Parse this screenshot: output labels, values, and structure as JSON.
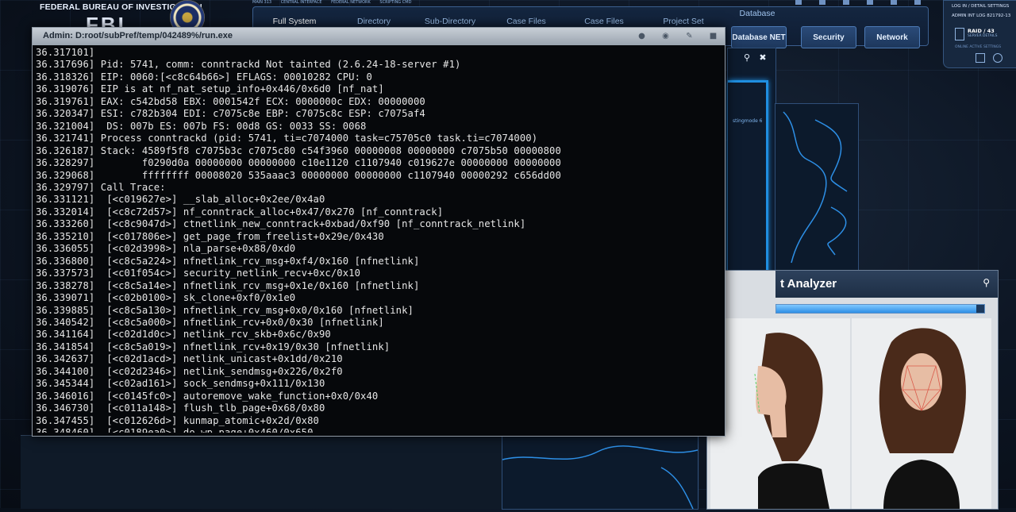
{
  "agency": {
    "title": "FEDERAL BUREAU OF INVESTIGATION",
    "abbr": "FBI"
  },
  "topnav": {
    "strip": [
      "MAIN 313",
      "CENTRAL INTERFACE",
      "FEDERAL NETWORK",
      "SCRIPTING CMD"
    ],
    "tabs": [
      "Full System",
      "Directory",
      "Sub-Directory",
      "Case Files",
      "Case Files",
      "Project Set",
      "Database"
    ],
    "buttons": [
      "Database NET",
      "Security",
      "Network"
    ]
  },
  "right_panel": {
    "line1": "LOG IN / DETAIL SETTINGS",
    "line2": "ADMIN INT LOG 821792-13",
    "raid": "RAID / 43",
    "raid_sub": "SERVER DETAILS",
    "foot": "ONLINE ACTIVE SETTINGS"
  },
  "map_window": {
    "tag": "stingmode 6"
  },
  "analyzer": {
    "title": "t Analyzer",
    "progress": 0.96
  },
  "terminal": {
    "title": "Admin: D:root/subPref/temp/042489%/run.exe",
    "lines": [
      "36.317101]",
      "36.317696] Pid: 5741, comm: conntrackd Not tainted (2.6.24-18-server #1)",
      "36.318326] EIP: 0060:[<c8c64b66>] EFLAGS: 00010282 CPU: 0",
      "36.319076] EIP is at nf_nat_setup_info+0x446/0x6d0 [nf_nat]",
      "36.319761] EAX: c542bd58 EBX: 0001542f ECX: 0000000c EDX: 00000000",
      "36.320347] ESI: c782b304 EDI: c7075c8e EBP: c7075c8c ESP: c7075af4",
      "36.321004]  DS: 007b ES: 007b FS: 00d8 GS: 0033 SS: 0068",
      "36.321741] Process conntrackd (pid: 5741, ti=c7074000 task=c75705c0 task.ti=c7074000)",
      "36.326187] Stack: 4589f5f8 c7075b3c c7075c80 c54f3960 00000008 00000000 c7075b50 00000800",
      "36.328297]        f0290d0a 00000000 00000000 c10e1120 c1107940 c019627e 00000000 00000000",
      "36.329068]        ffffffff 00008020 535aaac3 00000000 00000000 c1107940 00000292 c656dd00",
      "36.329797] Call Trace:",
      "36.331121]  [<c019627e>] __slab_alloc+0x2ee/0x4a0",
      "36.332014]  [<c8c72d57>] nf_conntrack_alloc+0x47/0x270 [nf_conntrack]",
      "36.333260]  [<c8c9047d>] ctnetlink_new_conntrack+0xbad/0xf90 [nf_conntrack_netlink]",
      "36.335210]  [<c017806e>] get_page_from_freelist+0x29e/0x430",
      "36.336055]  [<c02d3998>] nla_parse+0x88/0xd0",
      "36.336800]  [<c8c5a224>] nfnetlink_rcv_msg+0xf4/0x160 [nfnetlink]",
      "36.337573]  [<c01f054c>] security_netlink_recv+0xc/0x10",
      "36.338278]  [<c8c5a14e>] nfnetlink_rcv_msg+0x1e/0x160 [nfnetlink]",
      "36.339071]  [<c02b0100>] sk_clone+0xf0/0x1e0",
      "36.339885]  [<c8c5a130>] nfnetlink_rcv_msg+0x0/0x160 [nfnetlink]",
      "36.340542]  [<c8c5a000>] nfnetlink_rcv+0x0/0x30 [nfnetlink]",
      "36.341164]  [<c02d1d0c>] netlink_rcv_skb+0x6c/0x90",
      "36.341854]  [<c8c5a019>] nfnetlink_rcv+0x19/0x30 [nfnetlink]",
      "36.342637]  [<c02d1acd>] netlink_unicast+0x1dd/0x210",
      "36.344100]  [<c02d2346>] netlink_sendmsg+0x226/0x2f0",
      "36.345344]  [<c02ad161>] sock_sendmsg+0x111/0x130",
      "36.346016]  [<c0145fc0>] autoremove_wake_function+0x0/0x40",
      "36.346730]  [<c011a148>] flush_tlb_page+0x68/0x80",
      "36.347455]  [<c012626d>] kunmap_atomic+0x2d/0x80",
      "36.348460]  [<c0189ea0>] do_wp_page+0x460/0x650"
    ]
  },
  "colors": {
    "accent": "#1f8ee0",
    "terminal_bg": "#06080b",
    "terminal_text": "#e6e6e6"
  },
  "icons": [
    "bulb-icon",
    "globe-icon",
    "edit-icon",
    "lock-icon",
    "search-icon",
    "close-icon"
  ]
}
